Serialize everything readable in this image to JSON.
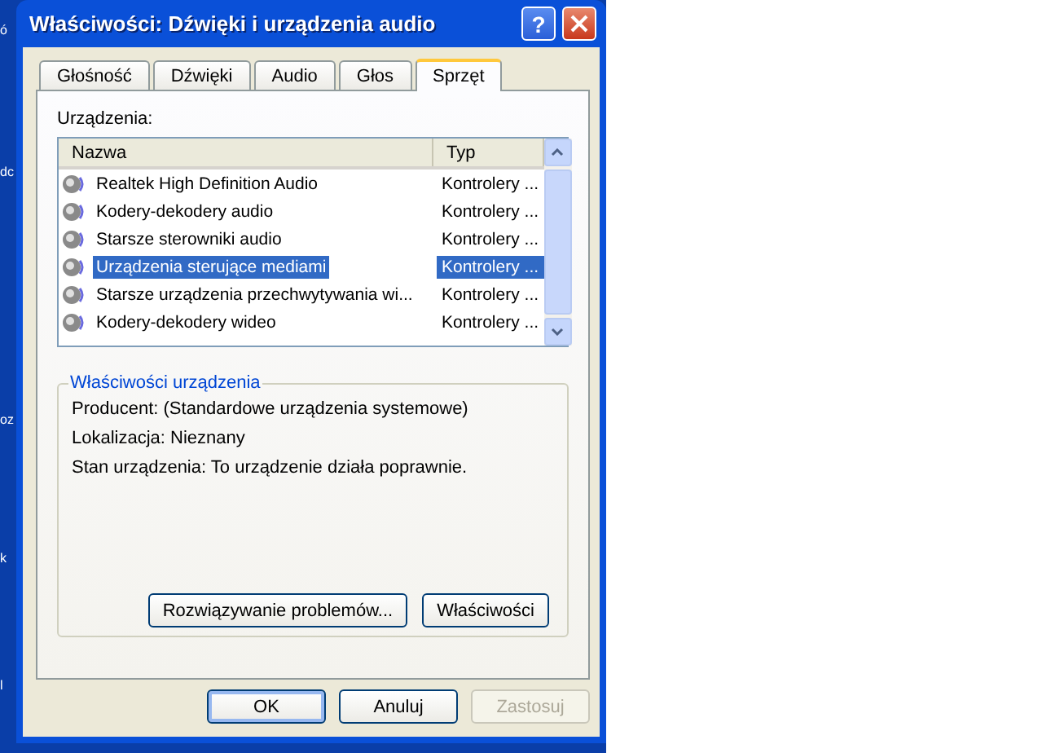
{
  "desktop": {
    "labels": [
      "ó",
      "dc",
      "oz",
      "k",
      "l"
    ]
  },
  "window": {
    "title": "Właściwości: Dźwięki i urządzenia audio",
    "help": "?"
  },
  "tabs": [
    {
      "label": "Głośność",
      "selected": false
    },
    {
      "label": "Dźwięki",
      "selected": false
    },
    {
      "label": "Audio",
      "selected": false
    },
    {
      "label": "Głos",
      "selected": false
    },
    {
      "label": "Sprzęt",
      "selected": true
    }
  ],
  "devices_label": "Urządzenia:",
  "list": {
    "columns": [
      "Nazwa",
      "Typ"
    ],
    "rows": [
      {
        "name": "Realtek High Definition Audio",
        "type": "Kontrolery ...",
        "selected": false
      },
      {
        "name": "Kodery-dekodery audio",
        "type": "Kontrolery ...",
        "selected": false
      },
      {
        "name": "Starsze sterowniki audio",
        "type": "Kontrolery ...",
        "selected": false
      },
      {
        "name": "Urządzenia sterujące mediami",
        "type": "Kontrolery ...",
        "selected": true
      },
      {
        "name": "Starsze urządzenia przechwytywania wi...",
        "type": "Kontrolery ...",
        "selected": false
      },
      {
        "name": "Kodery-dekodery wideo",
        "type": "Kontrolery ...",
        "selected": false
      }
    ]
  },
  "device_properties": {
    "title": "Właściwości urządzenia",
    "lines": [
      "Producent: (Standardowe urządzenia systemowe)",
      "Lokalizacja: Nieznany",
      "Stan urządzenia: To urządzenie działa poprawnie."
    ],
    "buttons": [
      "Rozwiązywanie problemów...",
      "Właściwości"
    ]
  },
  "buttons": [
    {
      "label": "OK",
      "disabled": false,
      "default": true
    },
    {
      "label": "Anuluj",
      "disabled": false,
      "default": false
    },
    {
      "label": "Zastosuj",
      "disabled": true,
      "default": false
    }
  ]
}
